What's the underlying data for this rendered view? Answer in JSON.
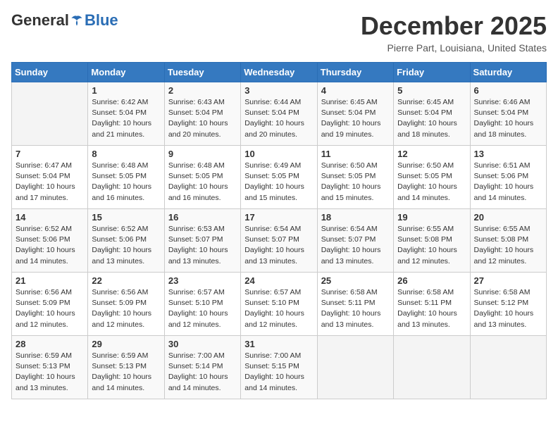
{
  "header": {
    "logo_general": "General",
    "logo_blue": "Blue",
    "month_title": "December 2025",
    "location": "Pierre Part, Louisiana, United States"
  },
  "weekdays": [
    "Sunday",
    "Monday",
    "Tuesday",
    "Wednesday",
    "Thursday",
    "Friday",
    "Saturday"
  ],
  "weeks": [
    [
      {
        "day": "",
        "info": ""
      },
      {
        "day": "1",
        "info": "Sunrise: 6:42 AM\nSunset: 5:04 PM\nDaylight: 10 hours\nand 21 minutes."
      },
      {
        "day": "2",
        "info": "Sunrise: 6:43 AM\nSunset: 5:04 PM\nDaylight: 10 hours\nand 20 minutes."
      },
      {
        "day": "3",
        "info": "Sunrise: 6:44 AM\nSunset: 5:04 PM\nDaylight: 10 hours\nand 20 minutes."
      },
      {
        "day": "4",
        "info": "Sunrise: 6:45 AM\nSunset: 5:04 PM\nDaylight: 10 hours\nand 19 minutes."
      },
      {
        "day": "5",
        "info": "Sunrise: 6:45 AM\nSunset: 5:04 PM\nDaylight: 10 hours\nand 18 minutes."
      },
      {
        "day": "6",
        "info": "Sunrise: 6:46 AM\nSunset: 5:04 PM\nDaylight: 10 hours\nand 18 minutes."
      }
    ],
    [
      {
        "day": "7",
        "info": "Sunrise: 6:47 AM\nSunset: 5:04 PM\nDaylight: 10 hours\nand 17 minutes."
      },
      {
        "day": "8",
        "info": "Sunrise: 6:48 AM\nSunset: 5:05 PM\nDaylight: 10 hours\nand 16 minutes."
      },
      {
        "day": "9",
        "info": "Sunrise: 6:48 AM\nSunset: 5:05 PM\nDaylight: 10 hours\nand 16 minutes."
      },
      {
        "day": "10",
        "info": "Sunrise: 6:49 AM\nSunset: 5:05 PM\nDaylight: 10 hours\nand 15 minutes."
      },
      {
        "day": "11",
        "info": "Sunrise: 6:50 AM\nSunset: 5:05 PM\nDaylight: 10 hours\nand 15 minutes."
      },
      {
        "day": "12",
        "info": "Sunrise: 6:50 AM\nSunset: 5:05 PM\nDaylight: 10 hours\nand 14 minutes."
      },
      {
        "day": "13",
        "info": "Sunrise: 6:51 AM\nSunset: 5:06 PM\nDaylight: 10 hours\nand 14 minutes."
      }
    ],
    [
      {
        "day": "14",
        "info": "Sunrise: 6:52 AM\nSunset: 5:06 PM\nDaylight: 10 hours\nand 14 minutes."
      },
      {
        "day": "15",
        "info": "Sunrise: 6:52 AM\nSunset: 5:06 PM\nDaylight: 10 hours\nand 13 minutes."
      },
      {
        "day": "16",
        "info": "Sunrise: 6:53 AM\nSunset: 5:07 PM\nDaylight: 10 hours\nand 13 minutes."
      },
      {
        "day": "17",
        "info": "Sunrise: 6:54 AM\nSunset: 5:07 PM\nDaylight: 10 hours\nand 13 minutes."
      },
      {
        "day": "18",
        "info": "Sunrise: 6:54 AM\nSunset: 5:07 PM\nDaylight: 10 hours\nand 13 minutes."
      },
      {
        "day": "19",
        "info": "Sunrise: 6:55 AM\nSunset: 5:08 PM\nDaylight: 10 hours\nand 12 minutes."
      },
      {
        "day": "20",
        "info": "Sunrise: 6:55 AM\nSunset: 5:08 PM\nDaylight: 10 hours\nand 12 minutes."
      }
    ],
    [
      {
        "day": "21",
        "info": "Sunrise: 6:56 AM\nSunset: 5:09 PM\nDaylight: 10 hours\nand 12 minutes."
      },
      {
        "day": "22",
        "info": "Sunrise: 6:56 AM\nSunset: 5:09 PM\nDaylight: 10 hours\nand 12 minutes."
      },
      {
        "day": "23",
        "info": "Sunrise: 6:57 AM\nSunset: 5:10 PM\nDaylight: 10 hours\nand 12 minutes."
      },
      {
        "day": "24",
        "info": "Sunrise: 6:57 AM\nSunset: 5:10 PM\nDaylight: 10 hours\nand 12 minutes."
      },
      {
        "day": "25",
        "info": "Sunrise: 6:58 AM\nSunset: 5:11 PM\nDaylight: 10 hours\nand 13 minutes."
      },
      {
        "day": "26",
        "info": "Sunrise: 6:58 AM\nSunset: 5:11 PM\nDaylight: 10 hours\nand 13 minutes."
      },
      {
        "day": "27",
        "info": "Sunrise: 6:58 AM\nSunset: 5:12 PM\nDaylight: 10 hours\nand 13 minutes."
      }
    ],
    [
      {
        "day": "28",
        "info": "Sunrise: 6:59 AM\nSunset: 5:13 PM\nDaylight: 10 hours\nand 13 minutes."
      },
      {
        "day": "29",
        "info": "Sunrise: 6:59 AM\nSunset: 5:13 PM\nDaylight: 10 hours\nand 14 minutes."
      },
      {
        "day": "30",
        "info": "Sunrise: 7:00 AM\nSunset: 5:14 PM\nDaylight: 10 hours\nand 14 minutes."
      },
      {
        "day": "31",
        "info": "Sunrise: 7:00 AM\nSunset: 5:15 PM\nDaylight: 10 hours\nand 14 minutes."
      },
      {
        "day": "",
        "info": ""
      },
      {
        "day": "",
        "info": ""
      },
      {
        "day": "",
        "info": ""
      }
    ]
  ]
}
